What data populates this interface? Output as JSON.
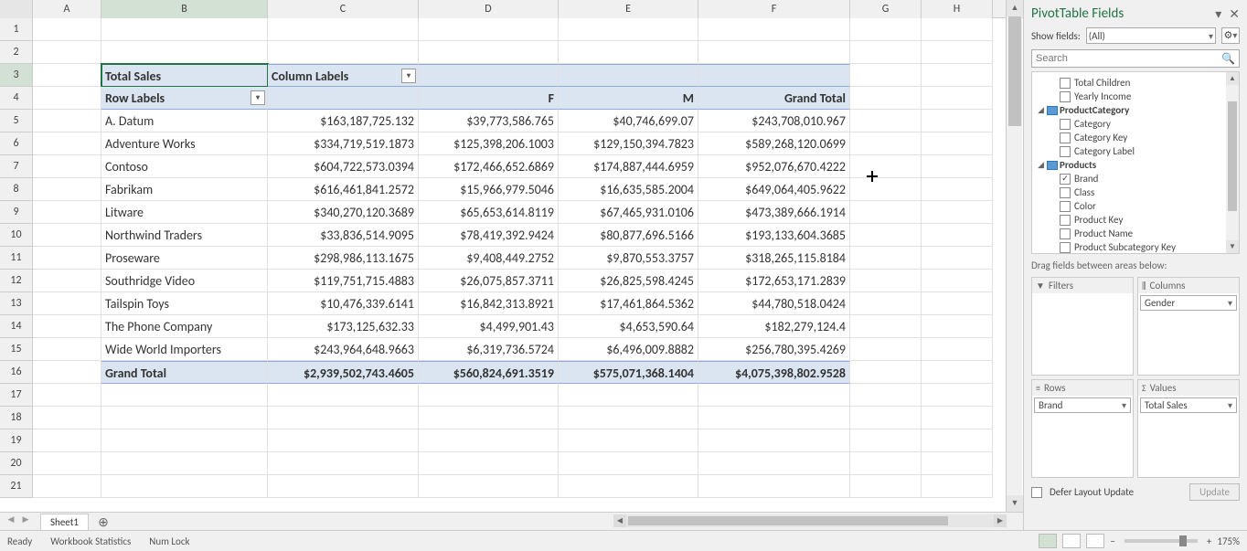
{
  "columns": [
    "A",
    "B",
    "C",
    "D",
    "E",
    "F",
    "G",
    "H"
  ],
  "row_nums": [
    1,
    2,
    3,
    4,
    5,
    6,
    7,
    8,
    9,
    10,
    11,
    12,
    13,
    14,
    15,
    16,
    17,
    18,
    19,
    20,
    21
  ],
  "pivot": {
    "title_cell": "Total Sales",
    "col_labels_cell": "Column Labels",
    "row_labels_cell": "Row Labels",
    "col_headers": [
      "",
      "F",
      "M",
      "Grand Total"
    ],
    "rows": [
      {
        "label": "A. Datum",
        "vals": [
          "$163,187,725.132",
          "$39,773,586.765",
          "$40,746,699.07",
          "$243,708,010.967"
        ]
      },
      {
        "label": "Adventure Works",
        "vals": [
          "$334,719,519.1873",
          "$125,398,206.1003",
          "$129,150,394.7823",
          "$589,268,120.0699"
        ]
      },
      {
        "label": "Contoso",
        "vals": [
          "$604,722,573.0394",
          "$172,466,652.6869",
          "$174,887,444.6959",
          "$952,076,670.4222"
        ]
      },
      {
        "label": "Fabrikam",
        "vals": [
          "$616,461,841.2572",
          "$15,966,979.5046",
          "$16,635,585.2004",
          "$649,064,405.9622"
        ]
      },
      {
        "label": "Litware",
        "vals": [
          "$340,270,120.3689",
          "$65,653,614.8119",
          "$67,465,931.0106",
          "$473,389,666.1914"
        ]
      },
      {
        "label": "Northwind Traders",
        "vals": [
          "$33,836,514.9095",
          "$78,419,392.9424",
          "$80,877,696.5166",
          "$193,133,604.3685"
        ]
      },
      {
        "label": "Proseware",
        "vals": [
          "$298,986,113.1675",
          "$9,408,449.2752",
          "$9,870,553.3757",
          "$318,265,115.8184"
        ]
      },
      {
        "label": "Southridge Video",
        "vals": [
          "$119,751,715.4883",
          "$26,075,857.3711",
          "$26,825,598.4245",
          "$172,653,171.2839"
        ]
      },
      {
        "label": "Tailspin Toys",
        "vals": [
          "$10,476,339.6141",
          "$16,842,313.8921",
          "$17,461,864.5362",
          "$44,780,518.0424"
        ]
      },
      {
        "label": "The Phone Company",
        "vals": [
          "$173,125,632.33",
          "$4,499,901.43",
          "$4,653,590.64",
          "$182,279,124.4"
        ]
      },
      {
        "label": "Wide World Importers",
        "vals": [
          "$243,964,648.9663",
          "$6,319,736.5724",
          "$6,496,009.8882",
          "$256,780,395.4269"
        ]
      }
    ],
    "grand_total_row": {
      "label": "Grand Total",
      "vals": [
        "$2,939,502,743.4605",
        "$560,824,691.3519",
        "$575,071,368.1404",
        "$4,075,398,802.9528"
      ]
    }
  },
  "sheet_tab": "Sheet1",
  "status": {
    "ready": "Ready",
    "wbstats": "Workbook Statistics",
    "numlock": "Num Lock",
    "zoom": "175%"
  },
  "ptf": {
    "title": "PivotTable Fields",
    "show_fields_label": "Show fields:",
    "show_fields_value": "(All)",
    "search_placeholder": "Search",
    "fields": [
      {
        "type": "field",
        "indent": 1,
        "checked": false,
        "label": "Total Children"
      },
      {
        "type": "field",
        "indent": 1,
        "checked": false,
        "label": "Yearly Income"
      },
      {
        "type": "table",
        "indent": 0,
        "label": "ProductCategory"
      },
      {
        "type": "field",
        "indent": 1,
        "checked": false,
        "label": "Category"
      },
      {
        "type": "field",
        "indent": 1,
        "checked": false,
        "label": "Category Key"
      },
      {
        "type": "field",
        "indent": 1,
        "checked": false,
        "label": "Category Label"
      },
      {
        "type": "table",
        "indent": 0,
        "label": "Products"
      },
      {
        "type": "field",
        "indent": 1,
        "checked": true,
        "label": "Brand"
      },
      {
        "type": "field",
        "indent": 1,
        "checked": false,
        "label": "Class"
      },
      {
        "type": "field",
        "indent": 1,
        "checked": false,
        "label": "Color"
      },
      {
        "type": "field",
        "indent": 1,
        "checked": false,
        "label": "Product Key"
      },
      {
        "type": "field",
        "indent": 1,
        "checked": false,
        "label": "Product Name"
      },
      {
        "type": "field",
        "indent": 1,
        "checked": false,
        "label": "Product Subcategory Key"
      }
    ],
    "drag_label": "Drag fields between areas below:",
    "areas": {
      "filters": {
        "label": "Filters",
        "icon": "▼"
      },
      "columns": {
        "label": "Columns",
        "icon": "⫼",
        "chip": "Gender"
      },
      "rows": {
        "label": "Rows",
        "icon": "≡",
        "chip": "Brand"
      },
      "values": {
        "label": "Values",
        "icon": "Σ",
        "chip": "Total Sales"
      }
    },
    "defer_label": "Defer Layout Update",
    "update_label": "Update"
  },
  "chart_data": {
    "type": "table",
    "title": "Total Sales",
    "row_field": "Brand",
    "column_field": "Gender",
    "columns": [
      "(blank)",
      "F",
      "M",
      "Grand Total"
    ],
    "rows": [
      {
        "Brand": "A. Datum",
        "(blank)": 163187725.132,
        "F": 39773586.765,
        "M": 40746699.07,
        "Grand Total": 243708010.967
      },
      {
        "Brand": "Adventure Works",
        "(blank)": 334719519.1873,
        "F": 125398206.1003,
        "M": 129150394.7823,
        "Grand Total": 589268120.0699
      },
      {
        "Brand": "Contoso",
        "(blank)": 604722573.0394,
        "F": 172466652.6869,
        "M": 174887444.6959,
        "Grand Total": 952076670.4222
      },
      {
        "Brand": "Fabrikam",
        "(blank)": 616461841.2572,
        "F": 15966979.5046,
        "M": 16635585.2004,
        "Grand Total": 649064405.9622
      },
      {
        "Brand": "Litware",
        "(blank)": 340270120.3689,
        "F": 65653614.8119,
        "M": 67465931.0106,
        "Grand Total": 473389666.1914
      },
      {
        "Brand": "Northwind Traders",
        "(blank)": 33836514.9095,
        "F": 78419392.9424,
        "M": 80877696.5166,
        "Grand Total": 193133604.3685
      },
      {
        "Brand": "Proseware",
        "(blank)": 298986113.1675,
        "F": 9408449.2752,
        "M": 9870553.3757,
        "Grand Total": 318265115.8184
      },
      {
        "Brand": "Southridge Video",
        "(blank)": 119751715.4883,
        "F": 26075857.3711,
        "M": 26825598.4245,
        "Grand Total": 172653171.2839
      },
      {
        "Brand": "Tailspin Toys",
        "(blank)": 10476339.6141,
        "F": 16842313.8921,
        "M": 17461864.5362,
        "Grand Total": 44780518.0424
      },
      {
        "Brand": "The Phone Company",
        "(blank)": 173125632.33,
        "F": 4499901.43,
        "M": 4653590.64,
        "Grand Total": 182279124.4
      },
      {
        "Brand": "Wide World Importers",
        "(blank)": 243964648.9663,
        "F": 6319736.5724,
        "M": 6496009.8882,
        "Grand Total": 256780395.4269
      },
      {
        "Brand": "Grand Total",
        "(blank)": 2939502743.4605,
        "F": 560824691.3519,
        "M": 575071368.1404,
        "Grand Total": 4075398802.9528
      }
    ]
  }
}
